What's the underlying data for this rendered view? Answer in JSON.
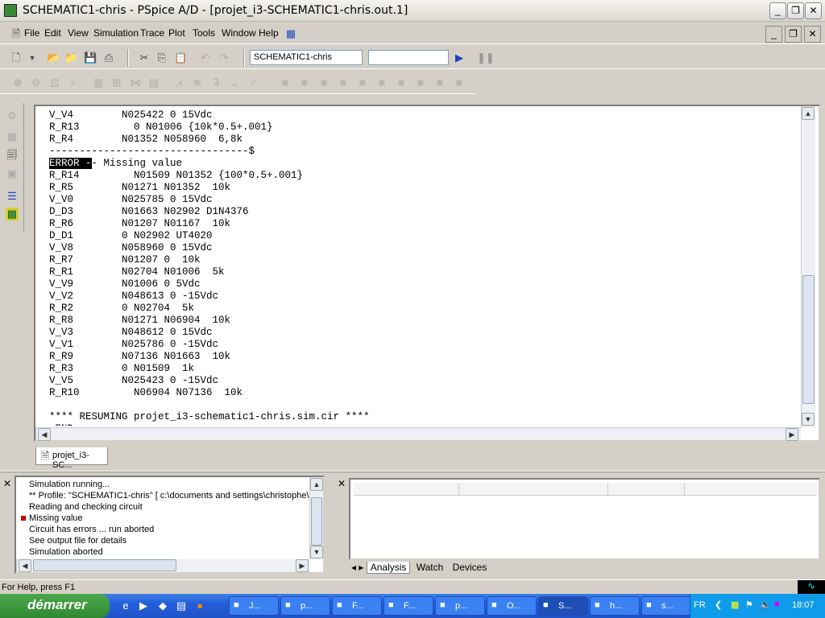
{
  "window": {
    "title": "SCHEMATIC1-chris - PSpice A/D  - [projet_i3-SCHEMATIC1-chris.out.1]"
  },
  "menu": [
    "File",
    "Edit",
    "View",
    "Simulation",
    "Trace",
    "Plot",
    "Tools",
    "Window",
    "Help"
  ],
  "toolbar": {
    "profile_value": "SCHEMATIC1-chris",
    "second_value": ""
  },
  "output": {
    "lines_before": [
      "V_V4        N025422 0 15Vdc",
      "R_R13         0 N01006 {10k*0.5+.001}",
      "R_R4        N01352 N058960  6,8k",
      "---------------------------------$"
    ],
    "error_highlight": "ERROR -",
    "error_rest": "- Missing value",
    "lines_after": [
      "R_R14         N01509 N01352 {100*0.5+.001}",
      "R_R5        N01271 N01352  10k",
      "V_V0        N025785 0 15Vdc",
      "D_D3        N01663 N02902 D1N4376",
      "R_R6        N01207 N01167  10k",
      "D_D1        0 N02902 UT4020",
      "V_V8        N058960 0 15Vdc",
      "R_R7        N01207 0  10k",
      "R_R1        N02704 N01006  5k",
      "V_V9        N01006 0 5Vdc",
      "V_V2        N048613 0 -15Vdc",
      "R_R2        0 N02704  5k",
      "R_R8        N01271 N06904  10k",
      "V_V3        N048612 0 15Vdc",
      "V_V1        N025786 0 -15Vdc",
      "R_R9        N07136 N01663  10k",
      "R_R3        0 N01509  1k",
      "V_V5        N025423 0 -15Vdc",
      "R_R10         N06904 N07136  10k",
      "",
      "**** RESUMING projet_i3-schematic1-chris.sim.cir ****",
      ".END"
    ]
  },
  "doc_tab": "projet_i3-SC...",
  "messages": [
    {
      "text": "Simulation running...",
      "error": false
    },
    {
      "text": "** Profile: \"SCHEMATIC1-chris\"  [ c:\\documents and settings\\christophe\\",
      "error": false
    },
    {
      "text": "Reading and checking circuit",
      "error": false
    },
    {
      "text": "Missing value",
      "error": true
    },
    {
      "text": "Circuit has errors ... run aborted",
      "error": false
    },
    {
      "text": "See output file for details",
      "error": false
    },
    {
      "text": "Simulation aborted",
      "error": false
    }
  ],
  "watch_tabs": [
    "Analysis",
    "Watch",
    "Devices"
  ],
  "status": "For Help, press F1",
  "taskbar": {
    "start": "démarrer",
    "tasks": [
      "J...",
      "p...",
      "F...",
      "F...",
      "p...",
      "O...",
      "S...",
      "h...",
      "s..."
    ],
    "active_task": 6,
    "lang": "FR",
    "clock": "18:07"
  },
  "colors": {
    "error_marker": "#c00000",
    "taskbar": "#245edb",
    "start": "#3c9a3c"
  }
}
